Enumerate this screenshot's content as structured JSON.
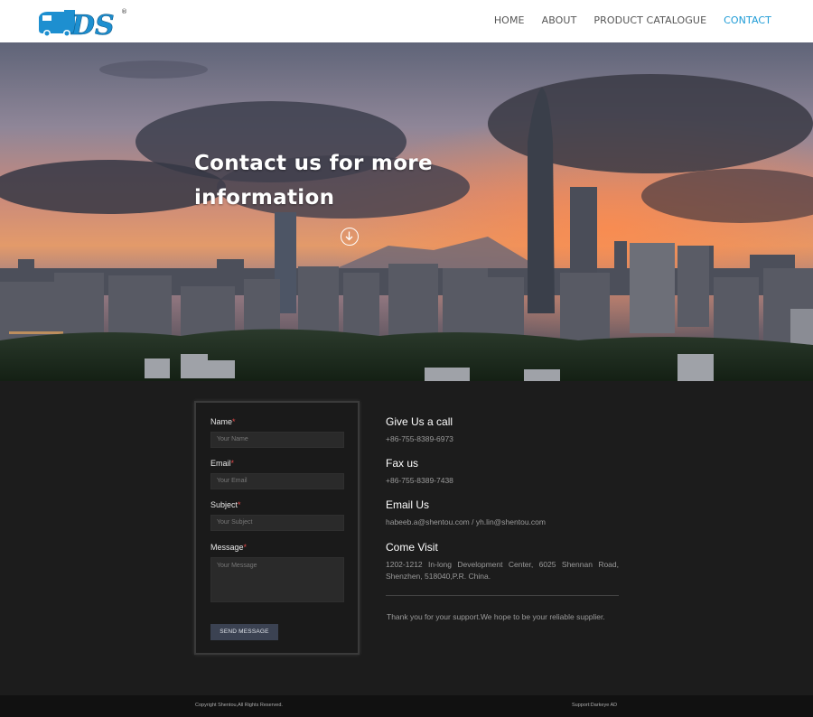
{
  "brand": {
    "logo_text": "DS",
    "registered": "®"
  },
  "nav": {
    "items": [
      {
        "label": "HOME",
        "active": false
      },
      {
        "label": "ABOUT",
        "active": false
      },
      {
        "label": "PRODUCT CATALOGUE",
        "active": false
      },
      {
        "label": "CONTACT",
        "active": true
      }
    ],
    "active_color": "#1d9bd6"
  },
  "hero": {
    "title_line1": "Contact us for more",
    "title_line2": "information",
    "scroll_icon": "arrow-down-circle-icon"
  },
  "form": {
    "name_label": "Name",
    "name_placeholder": "Your Name",
    "email_label": "Email",
    "email_placeholder": "Your Email",
    "subject_label": "Subject",
    "subject_placeholder": "Your Subject",
    "message_label": "Message",
    "message_placeholder": "Your Message",
    "required_mark": "*",
    "submit_label": "SEND MESSAGE"
  },
  "contact_info": {
    "call_title": "Give Us a call",
    "call_value": "+86-755-8389-6973",
    "fax_title": "Fax us",
    "fax_value": "+86-755-8389-7438",
    "email_title": "Email Us",
    "email_value": "habeeb.a@shentou.com / yh.lin@shentou.com",
    "visit_title": "Come Visit",
    "visit_value": "1202-1212 In-long Development Center, 6025 Shennan Road, Shenzhen, 518040,P.R. China.",
    "thanks": "Thank you for your support.We hope to be your reliable supplier."
  },
  "footer": {
    "copyright": "Copyright Shentou,All Rights Reserved.",
    "support": "Support:Darkeye AD"
  }
}
